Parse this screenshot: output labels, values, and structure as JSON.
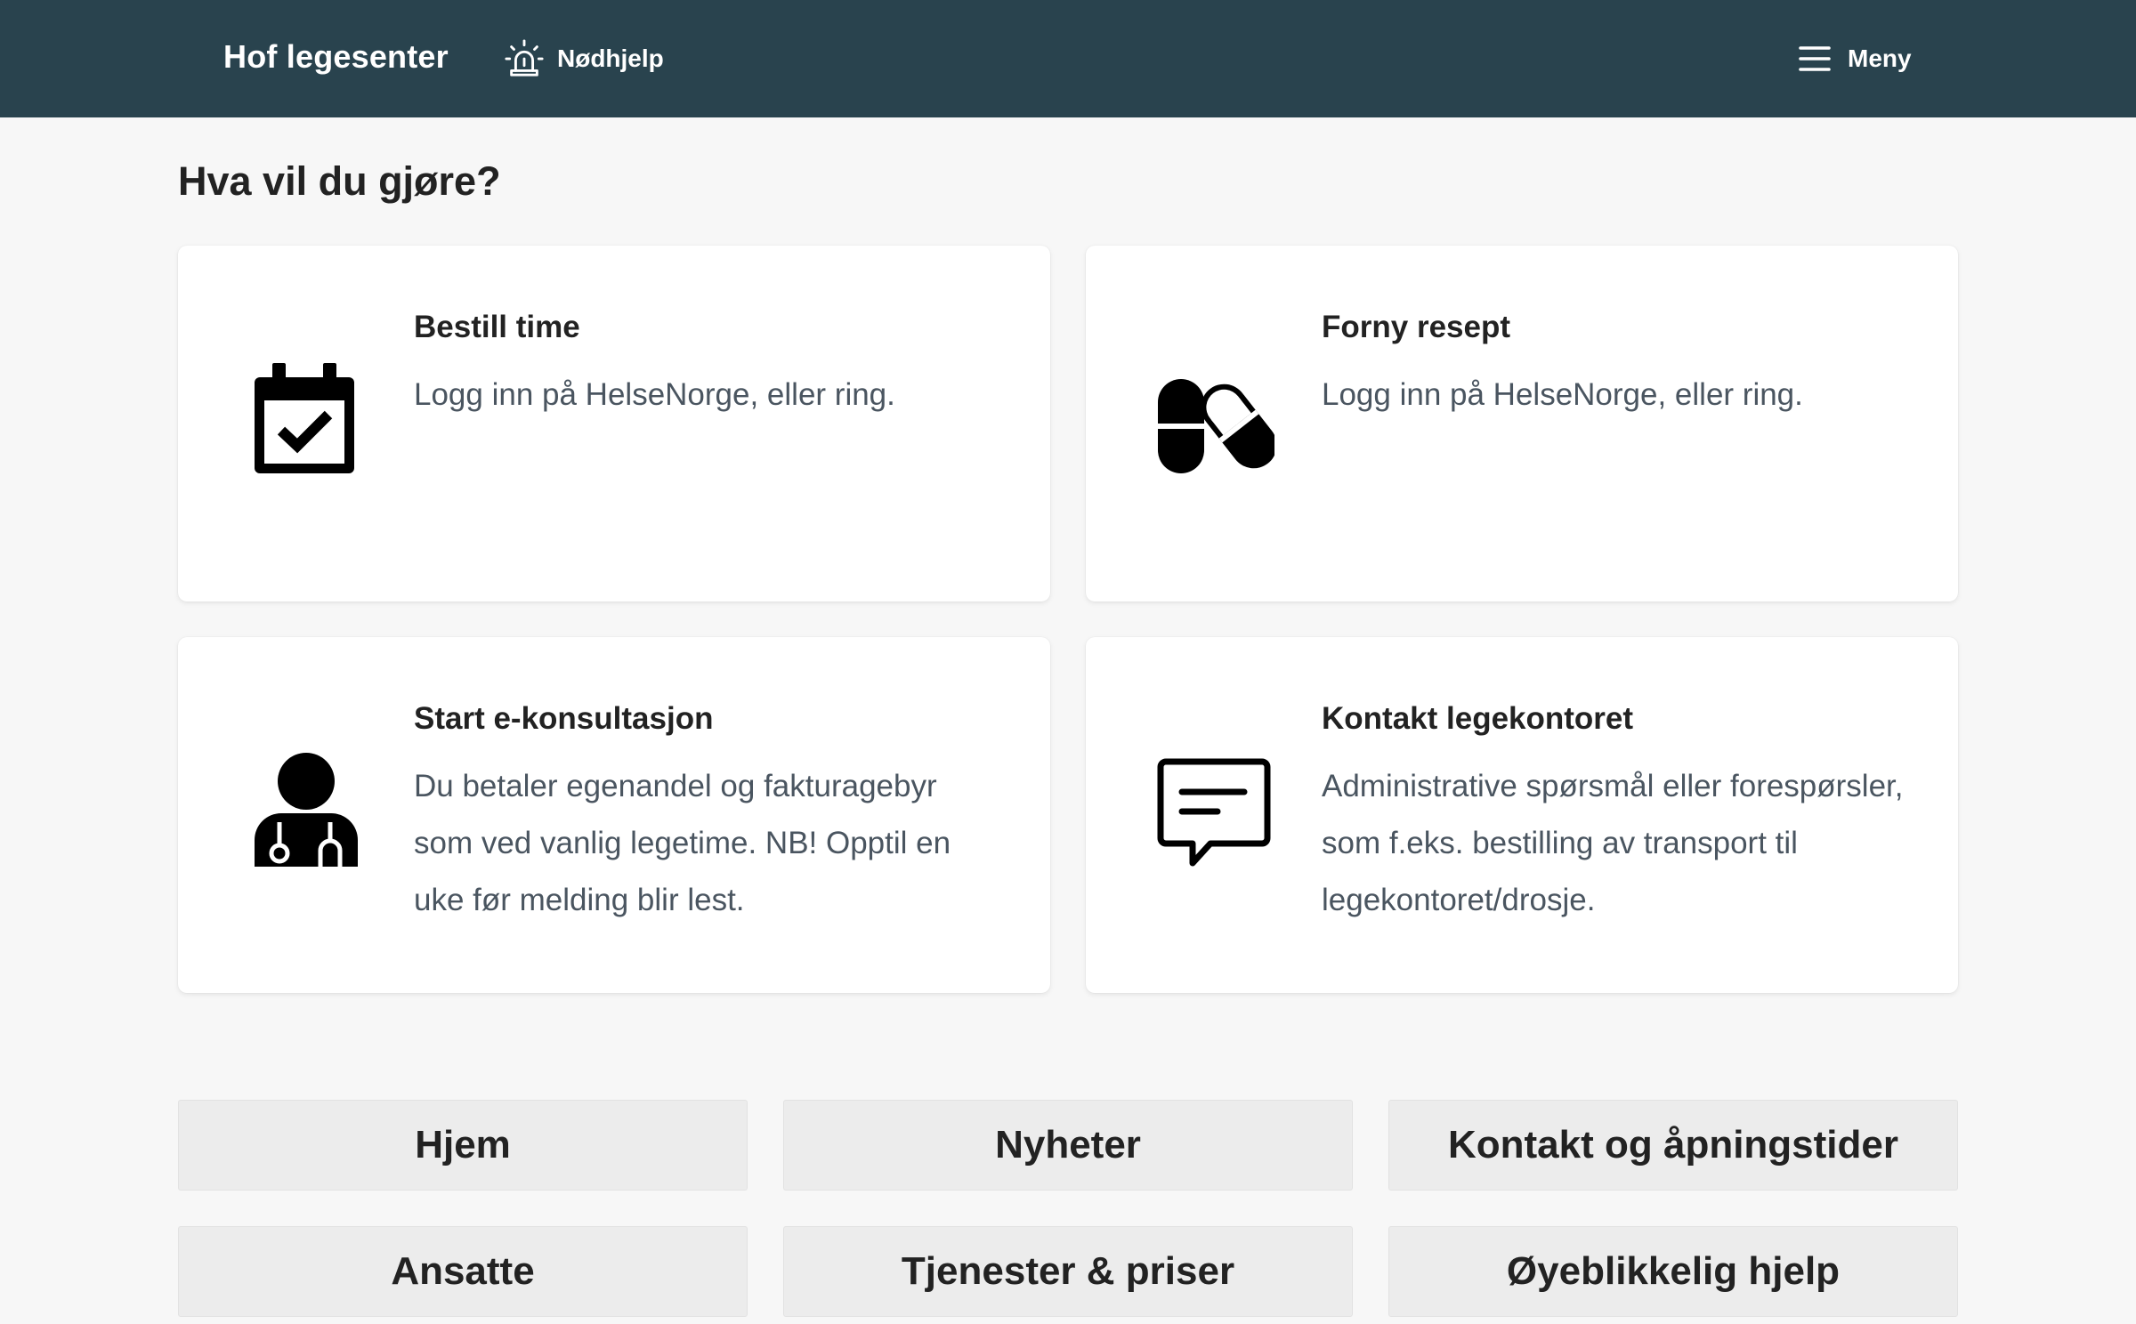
{
  "header": {
    "brand": "Hof legesenter",
    "emergency_label": "Nødhjelp",
    "emergency_icon": "siren-icon",
    "menu_label": "Meny",
    "menu_icon": "hamburger-icon",
    "background": "#29434e"
  },
  "main": {
    "title": "Hva vil du gjøre?",
    "cards": [
      {
        "title": "Bestill time",
        "description": "Logg inn på HelseNorge, eller ring.",
        "icon": "calendar-check-icon"
      },
      {
        "title": "Forny resept",
        "description": "Logg inn på HelseNorge, eller ring.",
        "icon": "pills-icon"
      },
      {
        "title": "Start e-konsultasjon",
        "description": "Du betaler egenandel og fakturagebyr som ved vanlig legetime. NB! Opptil en uke før melding blir lest.",
        "icon": "doctor-icon"
      },
      {
        "title": "Kontakt legekontoret",
        "description": "Administrative spørsmål eller forespørsler, som f.eks. bestilling av transport til legekontoret/drosje.",
        "icon": "chat-message-icon"
      }
    ]
  },
  "nav": {
    "buttons": [
      "Hjem",
      "Nyheter",
      "Kontakt og åpningstider",
      "Ansatte",
      "Tjenester & priser",
      "Øyeblikkelig hjelp"
    ]
  }
}
